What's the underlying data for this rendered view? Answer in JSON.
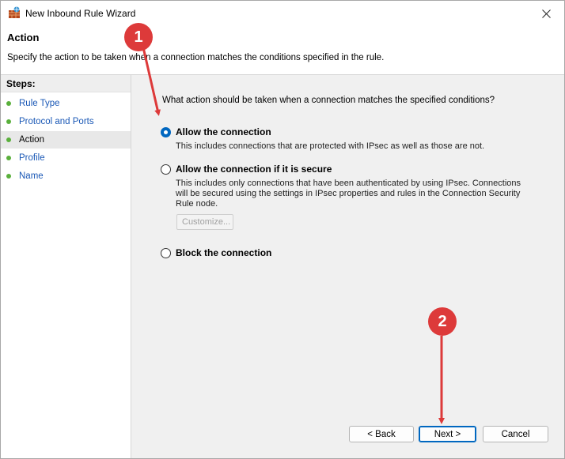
{
  "window": {
    "title": "New Inbound Rule Wizard"
  },
  "header": {
    "title": "Action",
    "description": "Specify the action to be taken when a connection matches the conditions specified in the rule."
  },
  "steps": {
    "label": "Steps:",
    "items": [
      {
        "label": "Rule Type",
        "current": false
      },
      {
        "label": "Protocol and Ports",
        "current": false
      },
      {
        "label": "Action",
        "current": true
      },
      {
        "label": "Profile",
        "current": false
      },
      {
        "label": "Name",
        "current": false
      }
    ]
  },
  "main": {
    "question": "What action should be taken when a connection matches the specified conditions?",
    "options": [
      {
        "label": "Allow the connection",
        "description": "This includes connections that are protected with IPsec as well as those are not.",
        "selected": true
      },
      {
        "label": "Allow the connection if it is secure",
        "description_lines": [
          "This includes only connections that have been authenticated by using IPsec.  Connections",
          "will be secured using the settings in IPsec properties and rules in the Connection Security",
          "Rule node."
        ],
        "selected": false
      },
      {
        "label": "Block the connection",
        "selected": false
      }
    ],
    "customize_label": "Customize..."
  },
  "footer": {
    "back_label": "< Back",
    "next_label": "Next >",
    "cancel_label": "Cancel"
  },
  "annotations": {
    "marker1": "1",
    "marker2": "2"
  },
  "colors": {
    "accent": "#0067c0",
    "annotation": "#dd3a3a",
    "step_dot": "#5ab03c",
    "link": "#1a58b6"
  },
  "icons": {
    "app": "firewall-icon",
    "close": "close-icon"
  }
}
